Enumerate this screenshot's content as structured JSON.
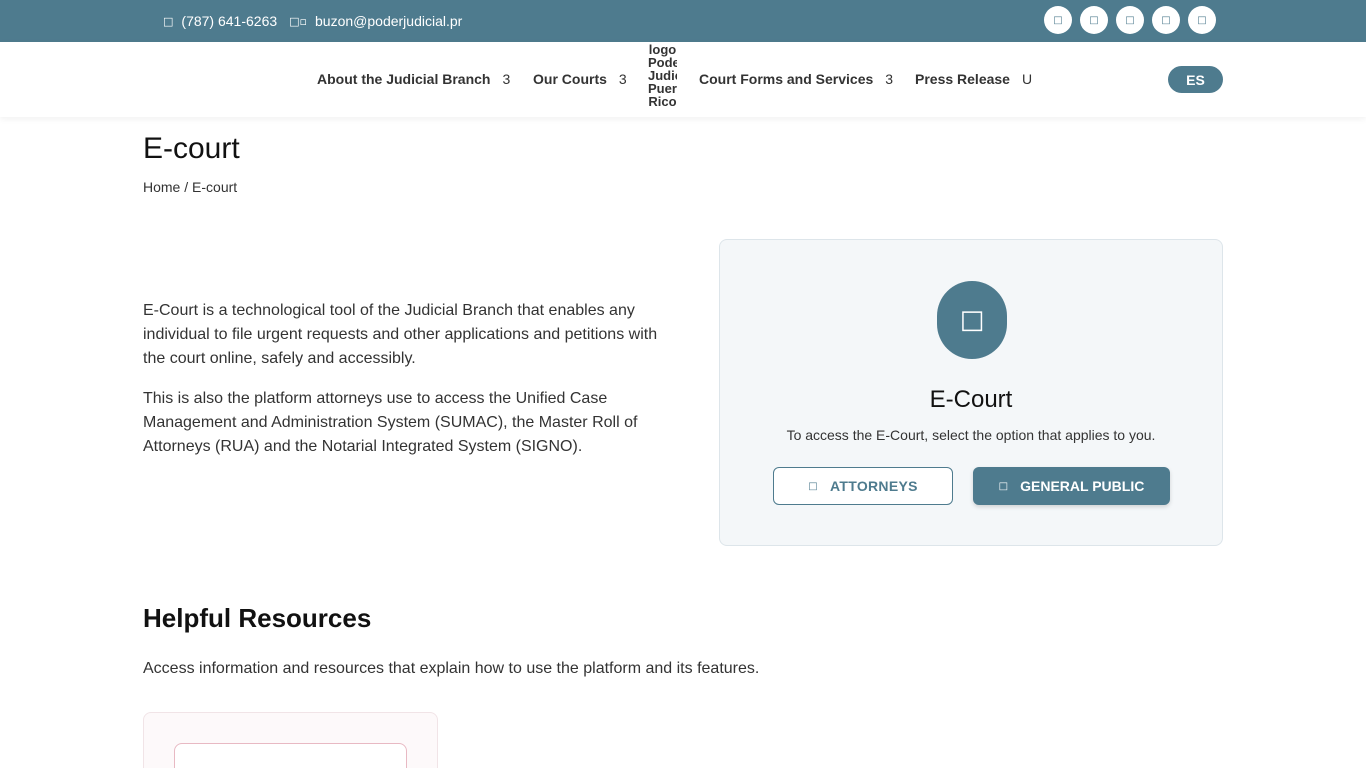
{
  "topbar": {
    "phone": "(787) 641-6263",
    "phone_icon": "phone-icon",
    "email": "buzon@poderjudicial.pr",
    "email_icon": "mail-icon",
    "social_icons": [
      "facebook-icon",
      "twitter-icon",
      "instagram-icon",
      "youtube-icon",
      "linkedin-icon"
    ],
    "accent_color": "#4e7b8e"
  },
  "nav": {
    "items": [
      {
        "label": "About the Judicial Branch",
        "chevron": "3"
      },
      {
        "label": "Our Courts",
        "chevron": "3"
      },
      {
        "label": "Court Forms and Services",
        "chevron": "3"
      },
      {
        "label": "Press Release",
        "chevron": "U"
      }
    ],
    "logo_alt": "logo Poder Judicial Puerto Rico",
    "lang_button": "ES"
  },
  "page": {
    "title": "E-court",
    "breadcrumb_home": "Home",
    "breadcrumb_sep": " / ",
    "breadcrumb_current": "E-court"
  },
  "intro": {
    "p1": "E-Court is a technological tool of the Judicial Branch that enables any individual to file urgent requests and other applications and petitions with the court online, safely and accessibly.",
    "p2": "This is also the platform attorneys use to access the Unified Case Management and Administration System (SUMAC), the Master Roll of Attorneys (RUA) and the Notarial Integrated System (SIGNO)."
  },
  "ecourt_card": {
    "icon": "laptop-icon",
    "title": "E-Court",
    "subtitle": "To access the E-Court, select the option that applies to you.",
    "attorneys_label": "ATTORNEYS",
    "public_label": "GENERAL PUBLIC"
  },
  "resources": {
    "title": "Helpful Resources",
    "subtitle": "Access information and resources that explain how to use the platform and its features."
  }
}
